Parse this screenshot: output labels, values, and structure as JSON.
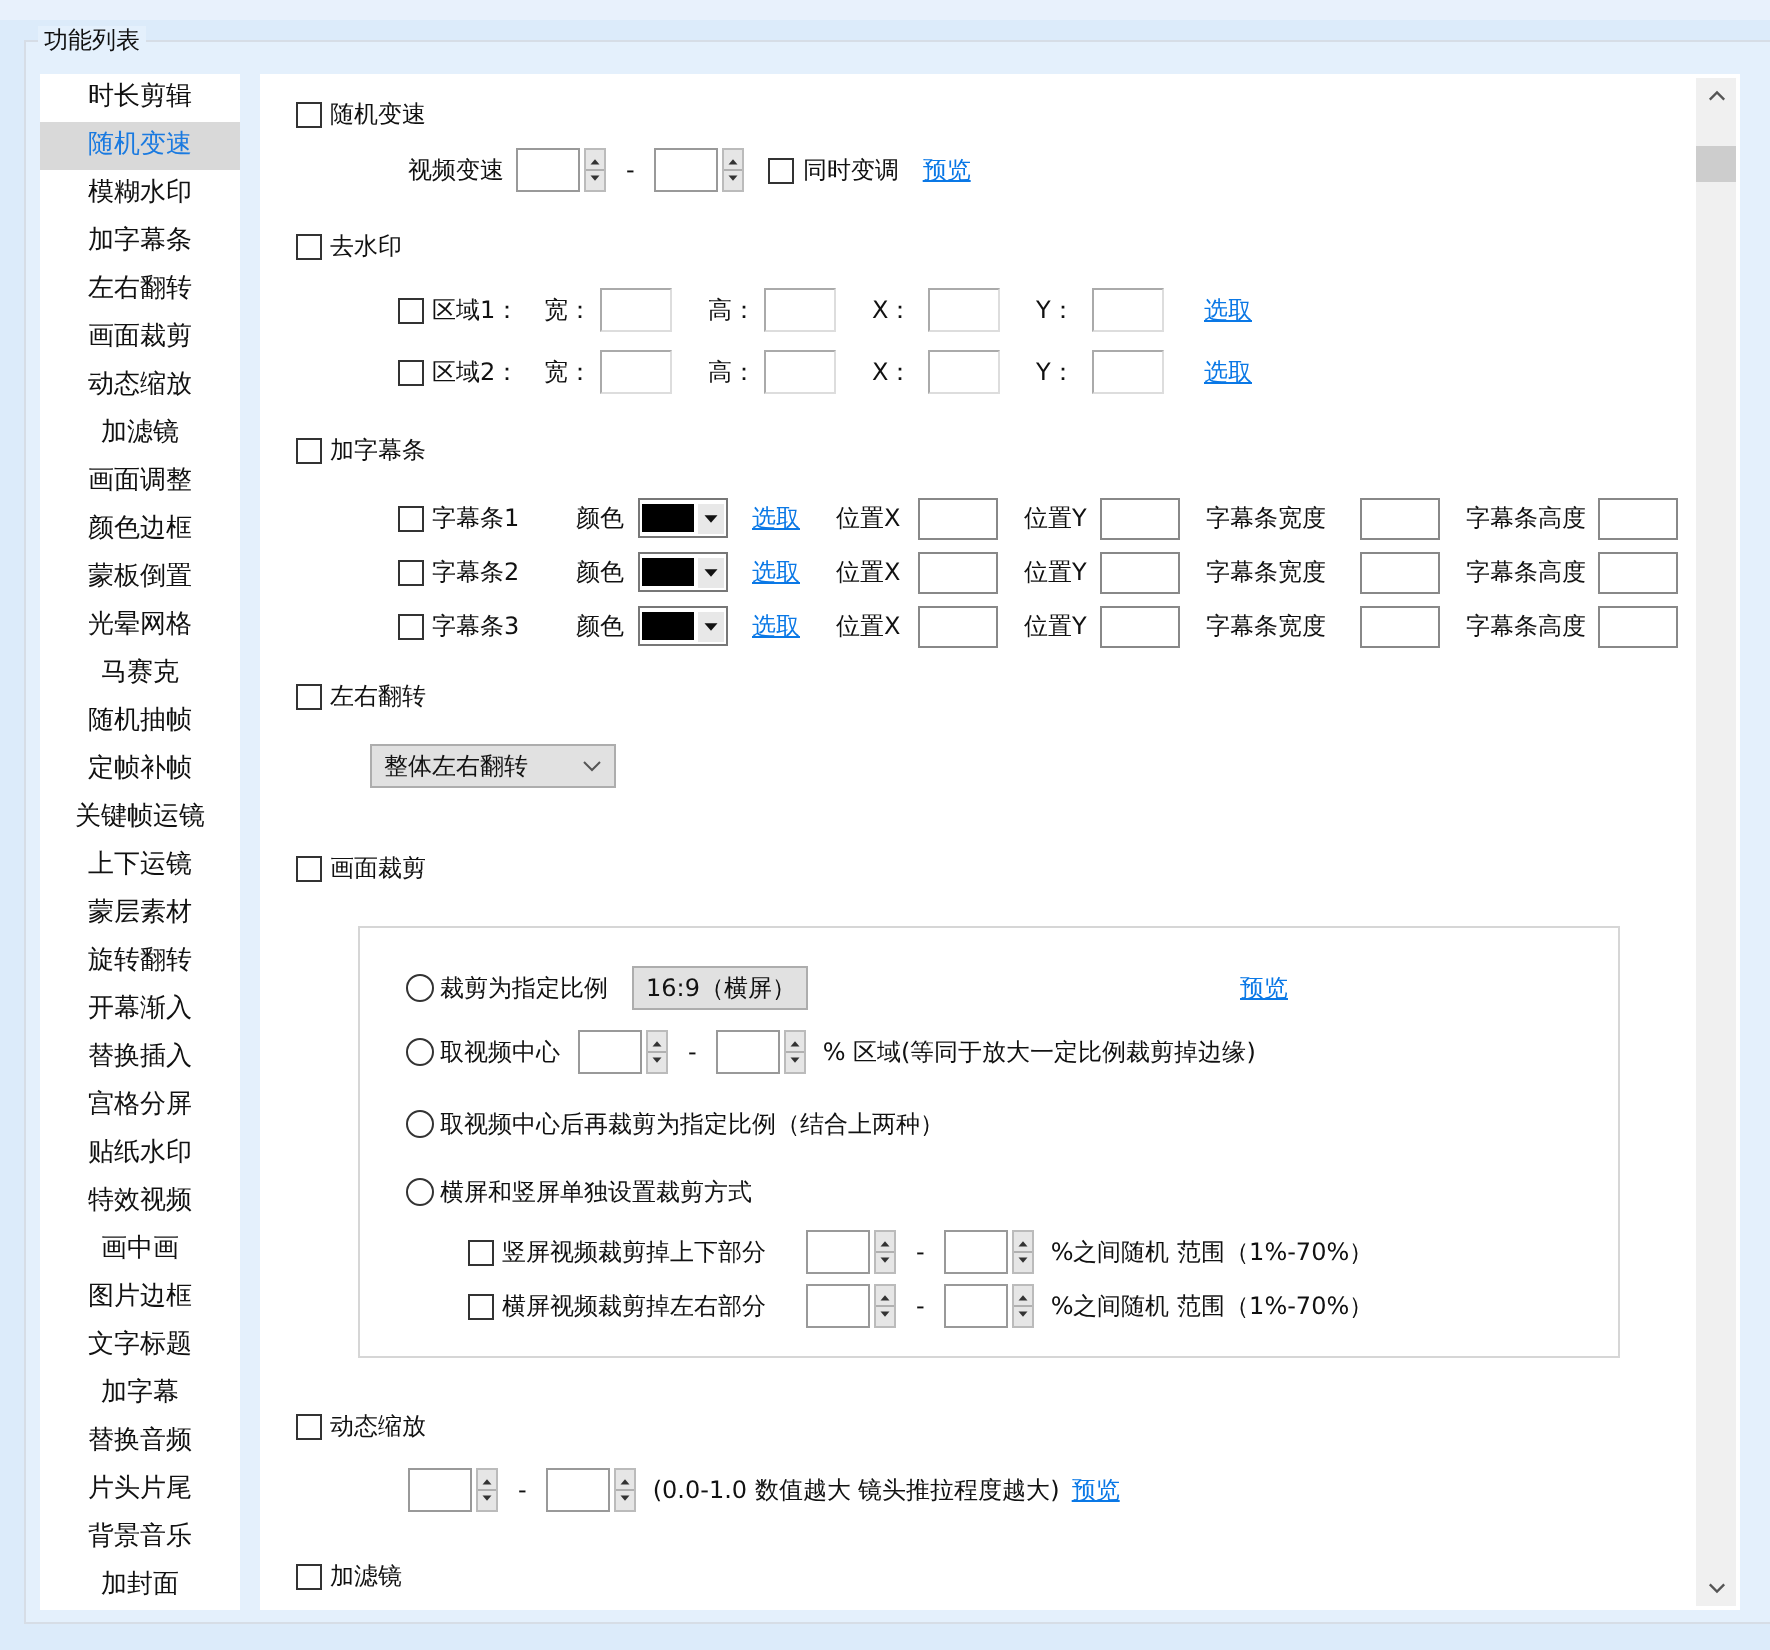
{
  "group_title": "功能列表",
  "sidebar": [
    {
      "label": "时长剪辑",
      "selected": false
    },
    {
      "label": "随机变速",
      "selected": true
    },
    {
      "label": "模糊水印",
      "selected": false
    },
    {
      "label": "加字幕条",
      "selected": false
    },
    {
      "label": "左右翻转",
      "selected": false
    },
    {
      "label": "画面裁剪",
      "selected": false
    },
    {
      "label": "动态缩放",
      "selected": false
    },
    {
      "label": "加滤镜",
      "selected": false
    },
    {
      "label": "画面调整",
      "selected": false
    },
    {
      "label": "颜色边框",
      "selected": false
    },
    {
      "label": "蒙板倒置",
      "selected": false
    },
    {
      "label": "光晕网格",
      "selected": false
    },
    {
      "label": "马赛克",
      "selected": false
    },
    {
      "label": "随机抽帧",
      "selected": false
    },
    {
      "label": "定帧补帧",
      "selected": false
    },
    {
      "label": "关键帧运镜",
      "selected": false
    },
    {
      "label": "上下运镜",
      "selected": false
    },
    {
      "label": "蒙层素材",
      "selected": false
    },
    {
      "label": "旋转翻转",
      "selected": false
    },
    {
      "label": "开幕渐入",
      "selected": false
    },
    {
      "label": "替换插入",
      "selected": false
    },
    {
      "label": "宫格分屏",
      "selected": false
    },
    {
      "label": "贴纸水印",
      "selected": false
    },
    {
      "label": "特效视频",
      "selected": false
    },
    {
      "label": "画中画",
      "selected": false
    },
    {
      "label": "图片边框",
      "selected": false
    },
    {
      "label": "文字标题",
      "selected": false
    },
    {
      "label": "加字幕",
      "selected": false
    },
    {
      "label": "替换音频",
      "selected": false
    },
    {
      "label": "片头片尾",
      "selected": false
    },
    {
      "label": "背景音乐",
      "selected": false
    },
    {
      "label": "加封面",
      "selected": false
    }
  ],
  "random_speed": {
    "title": "随机变速",
    "checked": false,
    "label": "视频变速",
    "separator": "-",
    "sync": {
      "label": "同时变调",
      "checked": false
    },
    "link": "预览"
  },
  "remove_watermark": {
    "title": "去水印",
    "checked": false,
    "regions": [
      {
        "label": "区域1：",
        "checked": false,
        "fields": [
          "宽：",
          "高：",
          "X：",
          "Y："
        ],
        "link": "选取"
      },
      {
        "label": "区域2：",
        "checked": false,
        "fields": [
          "宽：",
          "高：",
          "X：",
          "Y："
        ],
        "link": "选取"
      }
    ]
  },
  "subtitle_bars": {
    "title": "加字幕条",
    "checked": false,
    "rows": [
      {
        "label": "字幕条1",
        "checked": false,
        "color_label": "颜色",
        "color": "#000000",
        "link": "选取",
        "fields": [
          "位置X",
          "位置Y",
          "字幕条宽度",
          "字幕条高度"
        ]
      },
      {
        "label": "字幕条2",
        "checked": false,
        "color_label": "颜色",
        "color": "#000000",
        "link": "选取",
        "fields": [
          "位置X",
          "位置Y",
          "字幕条宽度",
          "字幕条高度"
        ]
      },
      {
        "label": "字幕条3",
        "checked": false,
        "color_label": "颜色",
        "color": "#000000",
        "link": "选取",
        "fields": [
          "位置X",
          "位置Y",
          "字幕条宽度",
          "字幕条高度"
        ]
      }
    ]
  },
  "flip": {
    "title": "左右翻转",
    "checked": false,
    "mode": "整体左右翻转"
  },
  "crop": {
    "title": "画面裁剪",
    "checked": false,
    "options": [
      {
        "kind": "ratio",
        "label": "裁剪为指定比例",
        "selected": false,
        "ratio": "16:9（横屏）",
        "link": "预览"
      },
      {
        "kind": "center",
        "label": "取视频中心",
        "selected": false,
        "separator": "-",
        "note": "% 区域(等同于放大一定比例裁剪掉边缘)"
      },
      {
        "kind": "text",
        "label": "取视频中心后再裁剪为指定比例（结合上两种）",
        "selected": false
      },
      {
        "kind": "text",
        "label": "横屏和竖屏单独设置裁剪方式",
        "selected": false
      }
    ],
    "sub_options": [
      {
        "label": "竖屏视频裁剪掉上下部分",
        "checked": false,
        "separator": "-",
        "note": "%之间随机 范围（1%-70%）"
      },
      {
        "label": "横屏视频裁剪掉左右部分",
        "checked": false,
        "separator": "-",
        "note": "%之间随机 范围（1%-70%）"
      }
    ]
  },
  "zoom": {
    "title": "动态缩放",
    "checked": false,
    "separator": "-",
    "note": "(0.0-1.0 数值越大 镜头推拉程度越大)",
    "link": "预览"
  },
  "filter": {
    "title": "加滤镜",
    "checked": false
  }
}
